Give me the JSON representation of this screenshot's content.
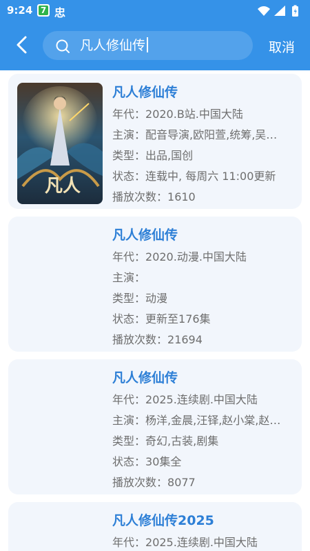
{
  "status_bar": {
    "time": "9:24",
    "badge": "7",
    "app_glyph": "忠"
  },
  "header": {
    "search_query": "凡人修仙传",
    "cancel_label": "取消"
  },
  "labels": {
    "year": "年代：",
    "cast": "主演：",
    "type": "类型：",
    "status": "状态：",
    "plays": "播放次数："
  },
  "results": [
    {
      "title": "凡人修仙传",
      "year": "2020.B站.中国大陆",
      "cast": "配音导演,欧阳萱,统筹,吴…",
      "type": "出品,国创",
      "status": "连载中, 每周六 11:00更新",
      "plays": "1610",
      "poster_text": "凡人"
    },
    {
      "title": "凡人修仙传",
      "year": "2020.动漫.中国大陆",
      "cast": "",
      "type": "动漫",
      "status": "更新至176集",
      "plays": "21694"
    },
    {
      "title": "凡人修仙传",
      "year": "2025.连续剧.中国大陆",
      "cast": "杨洋,金晨,汪铎,赵小棠,赵…",
      "type": "奇幻,古装,剧集",
      "status": "30集全",
      "plays": "8077"
    },
    {
      "title": "凡人修仙传2025",
      "year": "2025.连续剧.中国大陆"
    }
  ],
  "colors": {
    "header_bg": "#3592e8",
    "card_bg": "#f2f6fc",
    "title": "#2d7fd6",
    "text": "#6e6e6e"
  }
}
